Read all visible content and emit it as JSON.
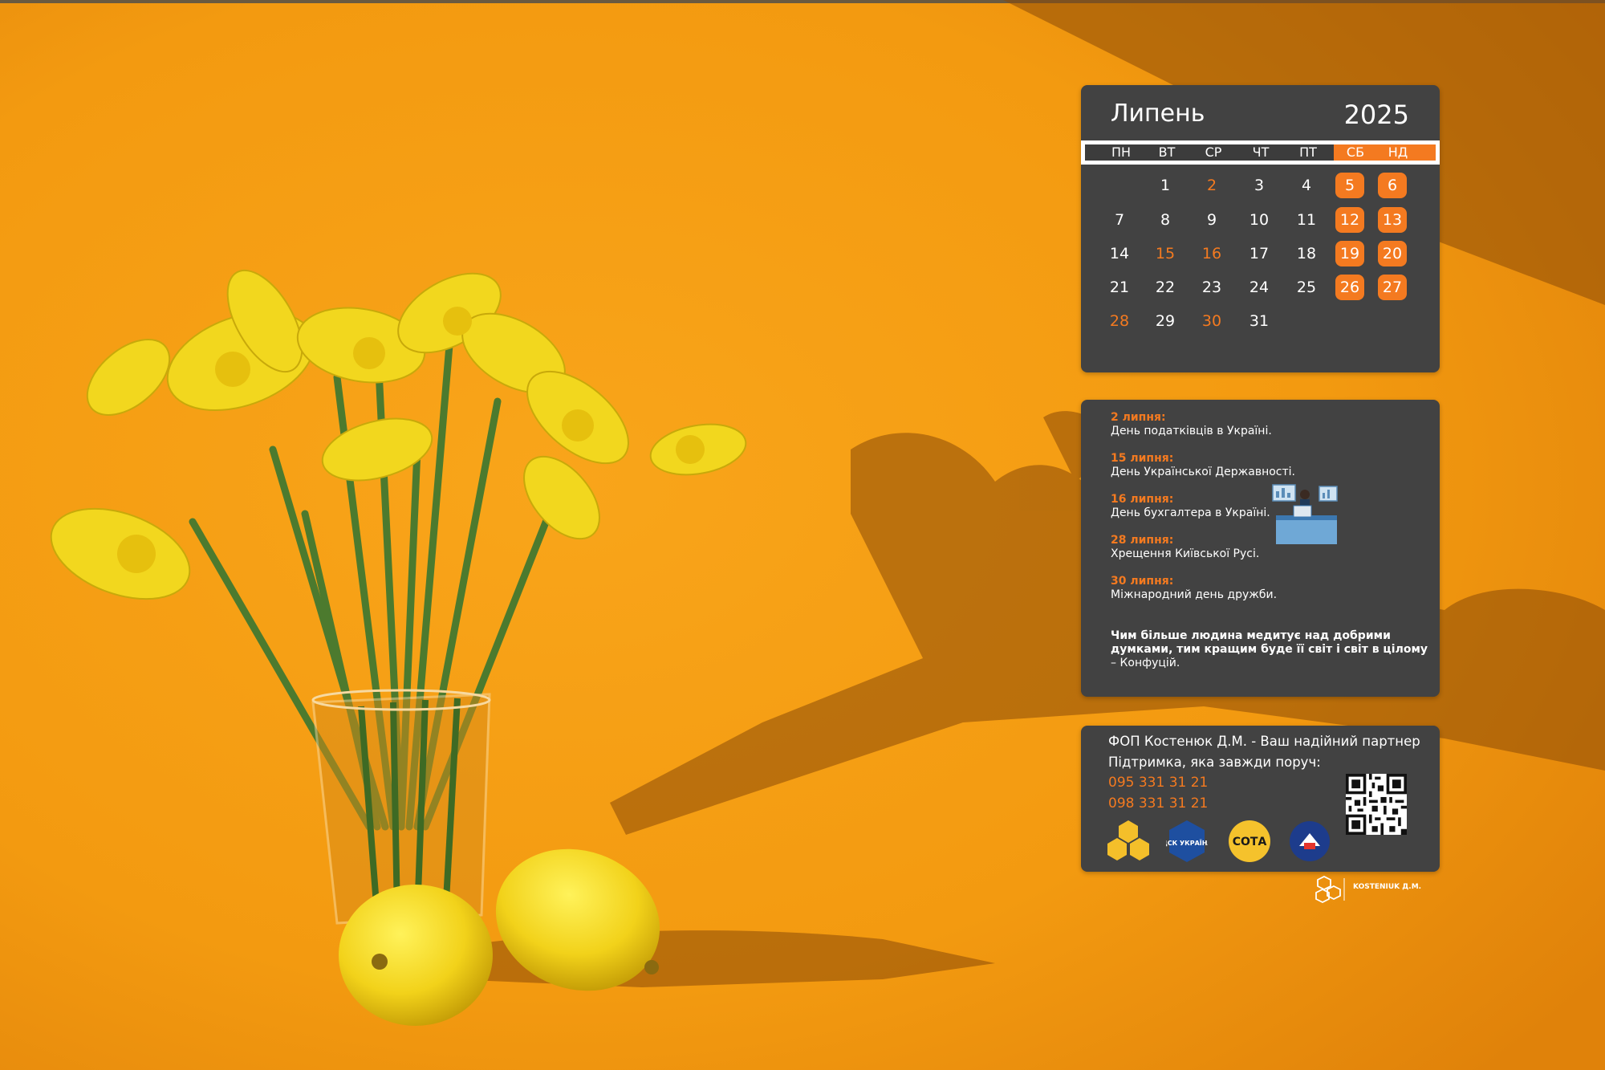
{
  "calendar": {
    "month": "Липень",
    "year": "2025",
    "weekdays": [
      "ПН",
      "ВТ",
      "СР",
      "ЧТ",
      "ПТ",
      "СБ",
      "НД"
    ],
    "weeks": [
      [
        "",
        "1",
        "2",
        "3",
        "4",
        "5",
        "6"
      ],
      [
        "7",
        "8",
        "9",
        "10",
        "11",
        "12",
        "13"
      ],
      [
        "14",
        "15",
        "16",
        "17",
        "18",
        "19",
        "20"
      ],
      [
        "21",
        "22",
        "23",
        "24",
        "25",
        "26",
        "27"
      ],
      [
        "28",
        "29",
        "30",
        "31",
        "",
        "",
        ""
      ]
    ],
    "highlighted_dates": [
      "2",
      "15",
      "16",
      "28",
      "30"
    ],
    "accent_color": "#f47a20",
    "panel_color": "#424242"
  },
  "events": [
    {
      "date": "2 липня:",
      "name": "День податківців в Україні."
    },
    {
      "date": "15 липня:",
      "name": "День Української Державності."
    },
    {
      "date": "16 липня:",
      "name": "День бухгалтера в Україні."
    },
    {
      "date": "28 липня:",
      "name": "Хрещення Київської Русі."
    },
    {
      "date": "30 липня:",
      "name": "Міжнародний день дружби."
    }
  ],
  "quote": {
    "text": "Чим більше людина медитує над добрими думками, тим кращим буде її світ і світ в цілому",
    "author": " – Конфуцій."
  },
  "contact": {
    "line1": "ФОП Костенюк Д.М. - Ваш надійний партнер",
    "line2": "Підтримка, яка завжди поруч:",
    "phone1": "095 331 31 21",
    "phone2": "098 331 31 21"
  },
  "logos": [
    {
      "icon": "honeycomb-logo"
    },
    {
      "icon": "csk-ukraine-logo",
      "label": "ЦСК УКРАЇНА"
    },
    {
      "icon": "sota-logo",
      "label": "СОТА"
    },
    {
      "icon": "medoc-logo"
    }
  ],
  "brand": {
    "text": "KOSTENIUK Д.М."
  }
}
